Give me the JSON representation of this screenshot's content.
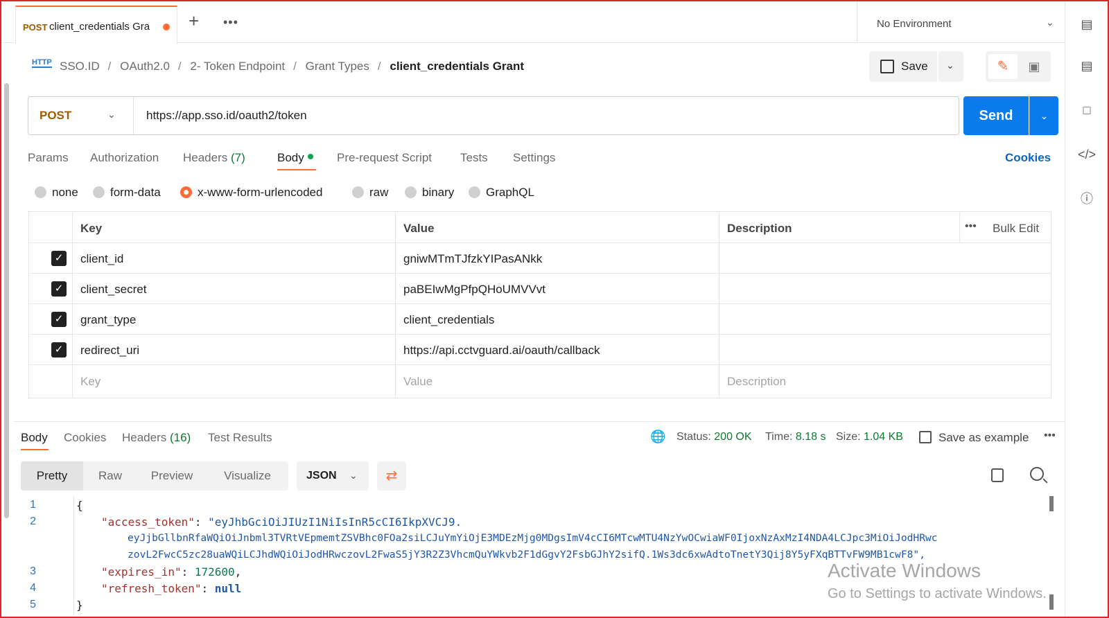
{
  "tab": {
    "method": "POST",
    "name": "client_credentials Gra"
  },
  "environment": {
    "label": "No Environment"
  },
  "breadcrumb": {
    "icon_label": "HTTP",
    "items": [
      "SSO.ID",
      "OAuth2.0",
      "2- Token Endpoint",
      "Grant Types"
    ],
    "current": "client_credentials Grant"
  },
  "toolbar": {
    "save_label": "Save"
  },
  "request": {
    "method": "POST",
    "url": "https://app.sso.id/oauth2/token",
    "send_label": "Send"
  },
  "request_tabs": {
    "params": "Params",
    "authorization": "Authorization",
    "headers": "Headers",
    "headers_count": "(7)",
    "body": "Body",
    "pre_request": "Pre-request Script",
    "tests": "Tests",
    "settings": "Settings",
    "cookies": "Cookies"
  },
  "body_types": [
    "none",
    "form-data",
    "x-www-form-urlencoded",
    "raw",
    "binary",
    "GraphQL"
  ],
  "selected_body_type": "x-www-form-urlencoded",
  "params_table": {
    "headers": {
      "key": "Key",
      "value": "Value",
      "description": "Description",
      "bulk_edit": "Bulk Edit"
    },
    "rows": [
      {
        "key": "client_id",
        "value": "gniwMTmTJfzkYIPasANkk",
        "checked": true
      },
      {
        "key": "client_secret",
        "value": "paBEIwMgPfpQHoUMVVvt",
        "checked": true
      },
      {
        "key": "grant_type",
        "value": "client_credentials",
        "checked": true
      },
      {
        "key": "redirect_uri",
        "value": "https://api.cctvguard.ai/oauth/callback",
        "checked": true
      }
    ],
    "placeholders": {
      "key": "Key",
      "value": "Value",
      "description": "Description"
    }
  },
  "response": {
    "tabs": {
      "body": "Body",
      "cookies": "Cookies",
      "headers": "Headers",
      "headers_count": "(16)",
      "test_results": "Test Results"
    },
    "status_label": "Status:",
    "status_value": "200 OK",
    "time_label": "Time:",
    "time_value": "8.18 s",
    "size_label": "Size:",
    "size_value": "1.04 KB",
    "save_example": "Save as example",
    "formats": [
      "Pretty",
      "Raw",
      "Preview",
      "Visualize"
    ],
    "language": "JSON",
    "code": {
      "line_numbers": [
        "1",
        "2",
        "3",
        "4",
        "5"
      ],
      "open_brace": "{",
      "close_brace": "}",
      "access_token_key": "\"access_token\"",
      "access_token_line1": "\"eyJhbGciOiJIUzI1NiIsInR5cCI6IkpXVCJ9.",
      "access_token_line2": "eyJjbGllbnRfaWQiOiJnbml3TVRtVEpmemtZSVBhc0FOa2siLCJuYmYiOjE3MDEzMjg0MDgsImV4cCI6MTcwMTU4NzYwOCwiaWF0IjoxNzAxMzI4NDA4LCJpc3MiOiJodHRwc",
      "access_token_line3": "zovL2FwcC5zc28uaWQiLCJhdWQiOiJodHRwczovL2FwaS5jY3R2Z3VhcmQuYWkvb2F1dGgvY2FsbGJhY2sifQ.1Ws3dc6xwAdtoTnetY3Qij8Y5yFXqBTTvFW9MB1cwF8\",",
      "expires_in_key": "\"expires_in\"",
      "expires_in_value": "172600",
      "refresh_token_key": "\"refresh_token\"",
      "refresh_token_value": "null"
    }
  },
  "watermark": {
    "line1": "Activate Windows",
    "line2": "Go to Settings to activate Windows."
  },
  "colors": {
    "accent": "#ff6c37",
    "send": "#097bed",
    "success": "#0c7a2f"
  }
}
